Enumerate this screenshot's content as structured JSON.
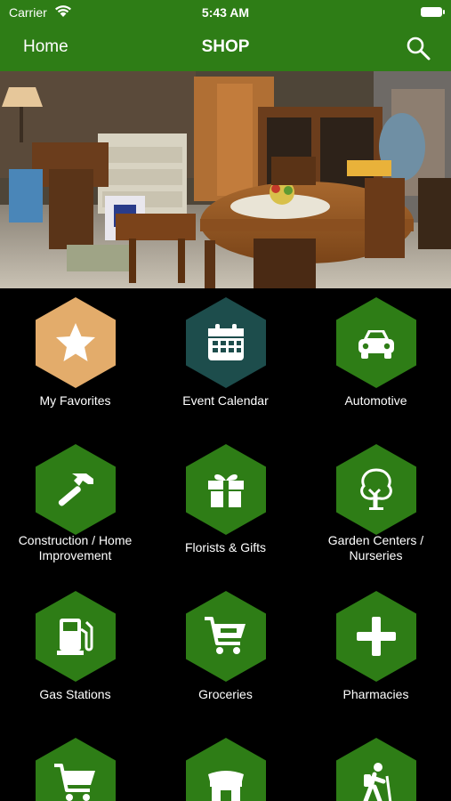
{
  "status_bar": {
    "carrier": "Carrier",
    "time": "5:43 AM"
  },
  "nav": {
    "home_label": "Home",
    "title": "SHOP"
  },
  "categories": [
    {
      "label": "My Favorites",
      "icon": "star-icon",
      "color": "#e3ac6b"
    },
    {
      "label": "Event Calendar",
      "icon": "calendar-icon",
      "color": "#1d4d4c"
    },
    {
      "label": "Automotive",
      "icon": "car-icon",
      "color": "#2e7d16"
    },
    {
      "label": "Construction / Home Improvement",
      "icon": "hammer-icon",
      "color": "#2e7d16"
    },
    {
      "label": "Florists & Gifts",
      "icon": "gift-icon",
      "color": "#2e7d16"
    },
    {
      "label": "Garden Centers / Nurseries",
      "icon": "tree-icon",
      "color": "#2e7d16"
    },
    {
      "label": "Gas Stations",
      "icon": "gas-pump-icon",
      "color": "#2e7d16"
    },
    {
      "label": "Groceries",
      "icon": "shopping-cart-icon",
      "color": "#2e7d16"
    },
    {
      "label": "Pharmacies",
      "icon": "plus-icon",
      "color": "#2e7d16"
    },
    {
      "label": "",
      "icon": "shopping-cart-icon",
      "color": "#2e7d16"
    },
    {
      "label": "",
      "icon": "storefront-icon",
      "color": "#2e7d16"
    },
    {
      "label": "",
      "icon": "hiker-icon",
      "color": "#2e7d16"
    }
  ],
  "colors": {
    "brand_green": "#2e7d16",
    "background": "#000000"
  }
}
